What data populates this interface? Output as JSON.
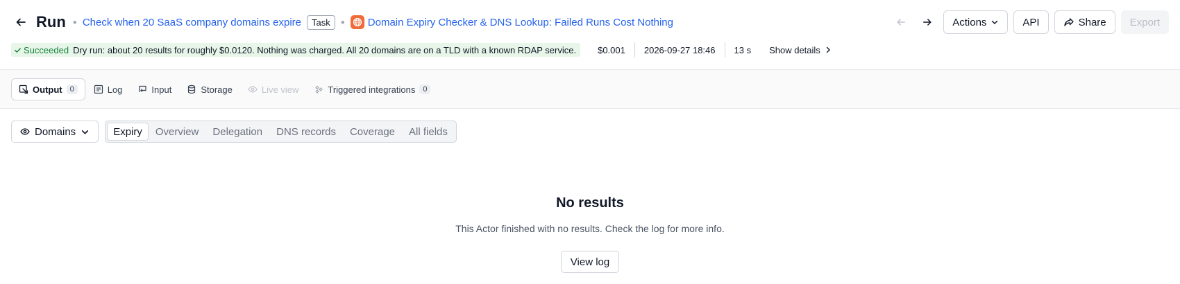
{
  "header": {
    "title": "Run",
    "task_name": "Check when 20 SaaS company domains expire",
    "task_badge": "Task",
    "actor_name": "Domain Expiry Checker & DNS Lookup: Failed Runs Cost Nothing",
    "actions_label": "Actions",
    "api_label": "API",
    "share_label": "Share",
    "export_label": "Export"
  },
  "status": {
    "state": "Succeeded",
    "message": "Dry run: about 20 results for roughly $0.0120. Nothing was charged. All 20 domains are on a TLD with a known RDAP service.",
    "cost": "$0.001",
    "started": "2026-09-27 18:46",
    "duration": "13 s",
    "show_details": "Show details"
  },
  "tabs": [
    {
      "label": "Output",
      "count": "0"
    },
    {
      "label": "Log"
    },
    {
      "label": "Input"
    },
    {
      "label": "Storage"
    },
    {
      "label": "Live view"
    },
    {
      "label": "Triggered integrations",
      "count": "0"
    }
  ],
  "view_select": {
    "label": "Domains"
  },
  "views": [
    "Expiry",
    "Overview",
    "Delegation",
    "DNS records",
    "Coverage",
    "All fields"
  ],
  "empty_state": {
    "title": "No results",
    "message": "This Actor finished with no results. Check the log for more info.",
    "button": "View log"
  },
  "colors": {
    "link": "#2563eb",
    "success": "#15803d",
    "success_bg": "#e7f6e9",
    "actor_icon": "#f06b39"
  }
}
